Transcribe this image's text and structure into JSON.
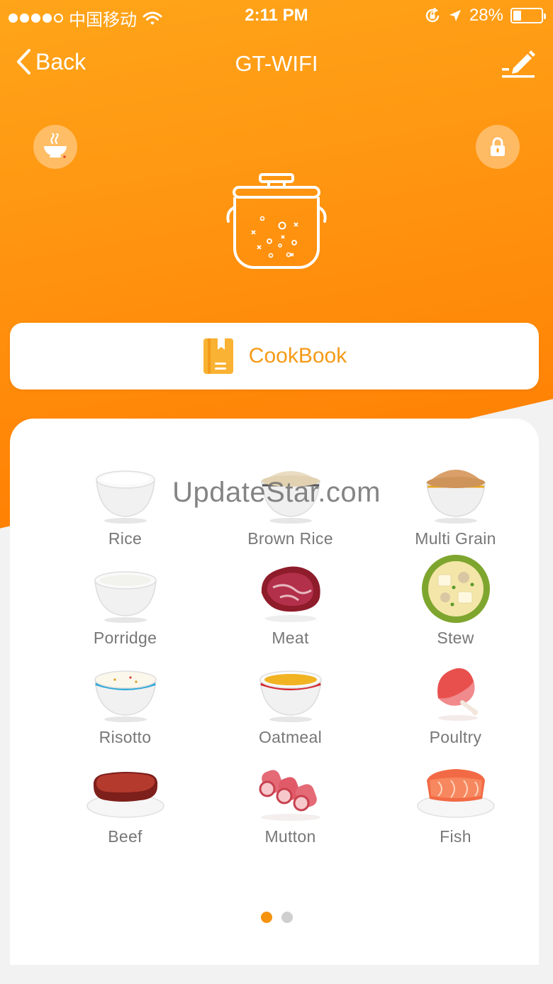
{
  "status_bar": {
    "carrier": "中国移动",
    "time": "2:11 PM",
    "battery": "28%",
    "battery_level": 0.28,
    "signal_bars": 4,
    "icons": [
      "wifi-icon",
      "rotation-lock-icon",
      "location-arrow-icon",
      "battery-icon"
    ]
  },
  "nav": {
    "back_label": "Back",
    "title": "GT-WIFI",
    "edit_icon": "edit-pencil-icon"
  },
  "device": {
    "left_button_icon": "bowl-steam-icon",
    "right_button_icon": "lock-icon",
    "image_icon": "rice-cooker-icon"
  },
  "cookbook": {
    "label": "CookBook",
    "icon": "book-icon"
  },
  "menus": [
    {
      "label": "Rice",
      "icon": "rice-bowl-icon"
    },
    {
      "label": "Brown Rice",
      "icon": "brown-rice-bowl-icon"
    },
    {
      "label": "Multi Grain",
      "icon": "multi-grain-bowl-icon"
    },
    {
      "label": "Porridge",
      "icon": "porridge-bowl-icon"
    },
    {
      "label": "Meat",
      "icon": "meat-icon"
    },
    {
      "label": "Stew",
      "icon": "stew-plate-icon"
    },
    {
      "label": "Risotto",
      "icon": "risotto-bowl-icon"
    },
    {
      "label": "Oatmeal",
      "icon": "oatmeal-bowl-icon"
    },
    {
      "label": "Poultry",
      "icon": "poultry-leg-icon"
    },
    {
      "label": "Beef",
      "icon": "beef-steak-icon"
    },
    {
      "label": "Mutton",
      "icon": "mutton-rolls-icon"
    },
    {
      "label": "Fish",
      "icon": "fish-steak-icon"
    }
  ],
  "pagination": {
    "pages": 2,
    "current": 1
  },
  "watermark": "UpdateStar.com",
  "colors": {
    "accent": "#ff9410",
    "accent_dark": "#ff7a00",
    "cookbook_text": "#f59a16",
    "label_gray": "#777777"
  }
}
